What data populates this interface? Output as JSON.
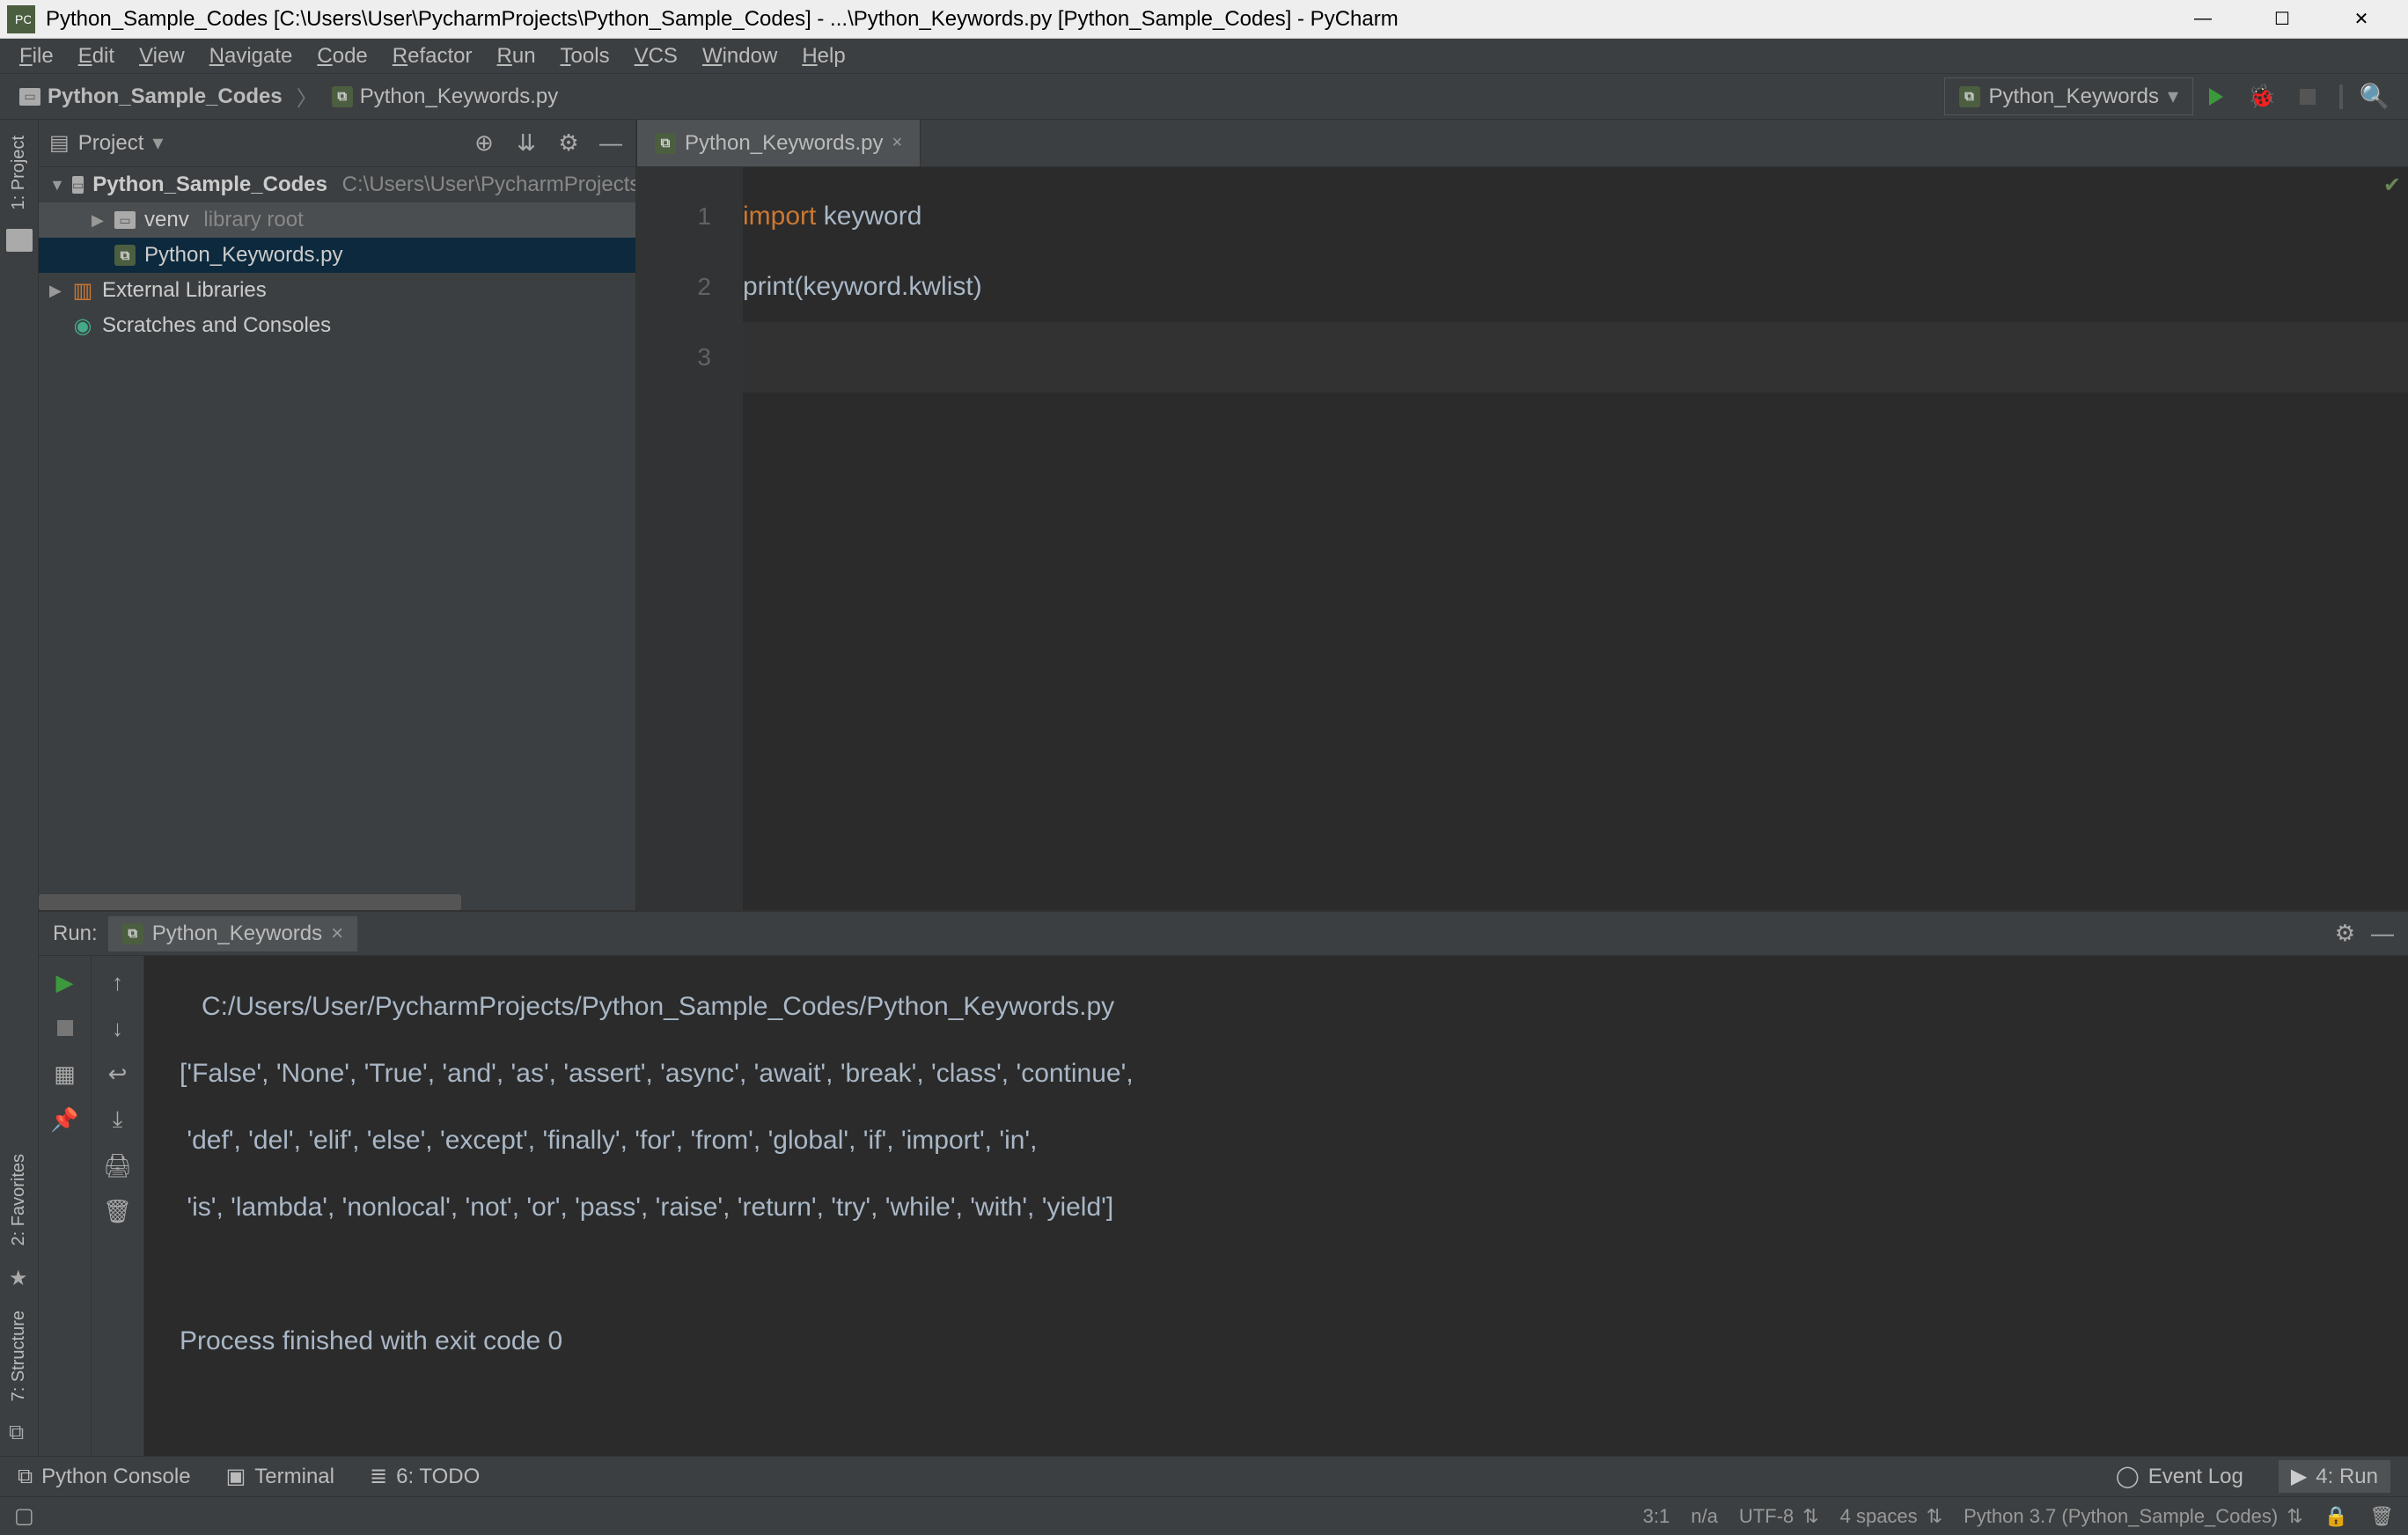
{
  "titlebar": {
    "title": "Python_Sample_Codes [C:\\Users\\User\\PycharmProjects\\Python_Sample_Codes] - ...\\Python_Keywords.py [Python_Sample_Codes] - PyCharm"
  },
  "menu": [
    "File",
    "Edit",
    "View",
    "Navigate",
    "Code",
    "Refactor",
    "Run",
    "Tools",
    "VCS",
    "Window",
    "Help"
  ],
  "breadcrumb": {
    "project": "Python_Sample_Codes",
    "file": "Python_Keywords.py"
  },
  "run_config": "Python_Keywords",
  "project_panel": {
    "title": "Project",
    "tree": [
      {
        "icon": "folder-icon",
        "label": "Python_Sample_Codes",
        "suffix": "C:\\Users\\User\\PycharmProjects",
        "indent": 0,
        "expanded": true
      },
      {
        "icon": "folder-icon",
        "label": "venv",
        "suffix": "library root",
        "indent": 1,
        "expanded": false,
        "hovered": true
      },
      {
        "icon": "py-icon",
        "label": "Python_Keywords.py",
        "indent": 1,
        "selected": true
      },
      {
        "icon": "lib-icon",
        "label": "External Libraries",
        "indent": 0,
        "expanded": false
      },
      {
        "icon": "scratch-icon",
        "label": "Scratches and Consoles",
        "indent": 0
      }
    ]
  },
  "editor": {
    "tab_label": "Python_Keywords.py",
    "lines": [
      {
        "n": "1",
        "tokens": [
          [
            "kw",
            "import"
          ],
          [
            "sp",
            " "
          ],
          [
            "pl",
            "keyword"
          ]
        ]
      },
      {
        "n": "2",
        "tokens": [
          [
            "fn",
            "print"
          ],
          [
            "pl",
            "(keyword.kwlist)"
          ]
        ]
      },
      {
        "n": "3",
        "tokens": [],
        "hl": true
      }
    ]
  },
  "run_panel": {
    "label": "Run:",
    "tab": "Python_Keywords",
    "console_lines": [
      "   C:/Users/User/PycharmProjects/Python_Sample_Codes/Python_Keywords.py",
      "['False', 'None', 'True', 'and', 'as', 'assert', 'async', 'await', 'break', 'class', 'continue',",
      " 'def', 'del', 'elif', 'else', 'except', 'finally', 'for', 'from', 'global', 'if', 'import', 'in',",
      " 'is', 'lambda', 'nonlocal', 'not', 'or', 'pass', 'raise', 'return', 'try', 'while', 'with', 'yield']",
      "",
      "Process finished with exit code 0"
    ]
  },
  "left_rail": {
    "top": "1: Project",
    "bottom": [
      "2: Favorites",
      "7: Structure"
    ]
  },
  "toolbar": {
    "items": [
      "Python Console",
      "Terminal",
      "6: TODO"
    ],
    "right": [
      "Event Log",
      "4: Run"
    ]
  },
  "statusbar": {
    "pos": "3:1",
    "na": "n/a",
    "encoding": "UTF-8",
    "indent": "4 spaces",
    "interpreter": "Python 3.7 (Python_Sample_Codes)"
  }
}
